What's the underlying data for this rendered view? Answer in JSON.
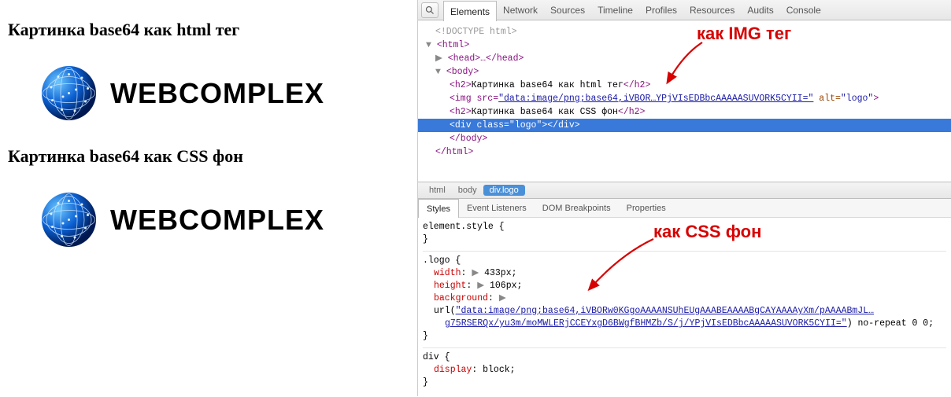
{
  "left": {
    "heading1": "Картинка base64 как html тег",
    "heading2": "Картинка base64 как CSS фон",
    "logo_text": "WEBCOMPLEX"
  },
  "devtools": {
    "tabs": [
      "Elements",
      "Network",
      "Sources",
      "Timeline",
      "Profiles",
      "Resources",
      "Audits",
      "Console"
    ],
    "active_tab": "Elements"
  },
  "dom": {
    "doctype": "<!DOCTYPE html>",
    "html_open": "<html>",
    "head": "<head>…</head>",
    "body_open": "<body>",
    "h2_1_open": "<h2>",
    "h2_1_text": "Картинка base64 как html тег",
    "h2_close": "</h2>",
    "img_open": "<img src=",
    "img_src": "\"data:image/png;base64,iVBOR…YPjVIsEDBbcAAAAASUVORK5CYII=\"",
    "img_alt_attr": " alt=",
    "img_alt_val": "\"logo\"",
    "img_close": ">",
    "h2_2_open": "<h2>",
    "h2_2_text": "Картинка base64 как CSS фон",
    "div_sel": "<div class=\"logo\"></div>",
    "body_close": "</body>",
    "html_close": "</html>"
  },
  "breadcrumb": {
    "items": [
      "html",
      "body",
      "div.logo"
    ],
    "active": "div.logo"
  },
  "styles_tabs": {
    "tabs": [
      "Styles",
      "Event Listeners",
      "DOM Breakpoints",
      "Properties"
    ],
    "active": "Styles"
  },
  "styles": {
    "element_rule": "element.style {",
    "close": "}",
    "logo_selector": ".logo {",
    "width_prop": "width",
    "width_val": "433px;",
    "height_prop": "height",
    "height_val": "106px;",
    "bg_prop": "background",
    "bg_url1": "\"data:image/png;base64,iVBORw0KGgoAAAANSUhEUgAAABEAAAABgCAYAAAAyXm/pAAAABmJL…",
    "bg_url2": "g75RSERQx/yu3m/moMWLERjCCEYxgD6BWgfBHMZb/S/j/YPjVIsEDBbcAAAAASUVORK5CYII=\"",
    "bg_url_prefix": "url(",
    "bg_url_suffix": ")",
    "bg_rest": " no-repeat 0 0;",
    "div_selector": "div {",
    "display_prop": "display",
    "display_val": "block;"
  },
  "annotations": {
    "img_tag": "как IMG тег",
    "css_bg": "как CSS фон"
  }
}
